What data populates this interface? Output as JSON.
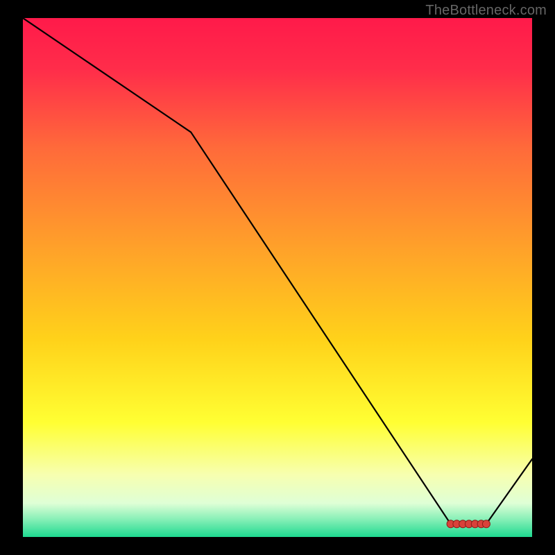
{
  "watermark": "TheBottleneck.com",
  "chart_data": {
    "type": "line",
    "title": "",
    "xlabel": "",
    "ylabel": "",
    "xlim": [
      0,
      100
    ],
    "ylim": [
      0,
      100
    ],
    "x": [
      0,
      33,
      84,
      91,
      100
    ],
    "values": [
      100,
      78,
      2.5,
      2.5,
      15
    ],
    "markers": {
      "x": [
        84,
        85.2,
        86.4,
        87.6,
        88.8,
        90,
        91
      ],
      "values": [
        2.5,
        2.5,
        2.5,
        2.5,
        2.5,
        2.5,
        2.5
      ]
    },
    "gradient_stops": [
      {
        "offset": 0.0,
        "color": "#ff1a4a"
      },
      {
        "offset": 0.1,
        "color": "#ff2d4a"
      },
      {
        "offset": 0.25,
        "color": "#ff6a3a"
      },
      {
        "offset": 0.45,
        "color": "#ffa329"
      },
      {
        "offset": 0.62,
        "color": "#ffd21a"
      },
      {
        "offset": 0.78,
        "color": "#ffff33"
      },
      {
        "offset": 0.88,
        "color": "#f7ffb0"
      },
      {
        "offset": 0.935,
        "color": "#dfffd6"
      },
      {
        "offset": 0.965,
        "color": "#8af0b8"
      },
      {
        "offset": 1.0,
        "color": "#1ed990"
      }
    ]
  }
}
